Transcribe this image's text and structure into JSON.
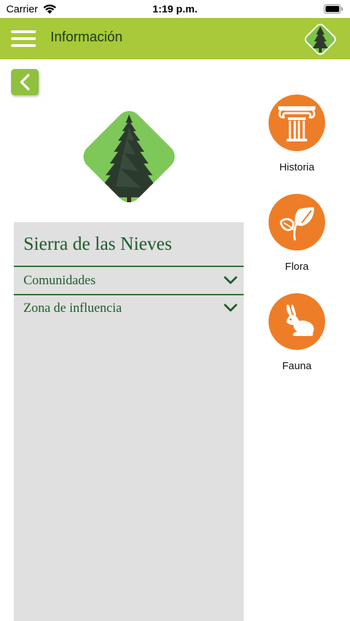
{
  "status_bar": {
    "carrier": "Carrier",
    "time": "1:19 p.m."
  },
  "nav": {
    "title": "Información"
  },
  "panel": {
    "title": "Sierra de las Nieves",
    "items": [
      {
        "label": "Comunidades"
      },
      {
        "label": "Zona de influencia"
      }
    ]
  },
  "side_menu": [
    {
      "label": "Historia",
      "icon": "column-icon"
    },
    {
      "label": "Flora",
      "icon": "leaf-icon"
    },
    {
      "label": "Fauna",
      "icon": "rabbit-icon"
    }
  ],
  "colors": {
    "nav_bar": "#a7c93a",
    "back_button": "#8fc13e",
    "accent_orange": "#ee7d27",
    "text_green": "#1e5d2a",
    "panel_background": "#e0e0e0"
  }
}
